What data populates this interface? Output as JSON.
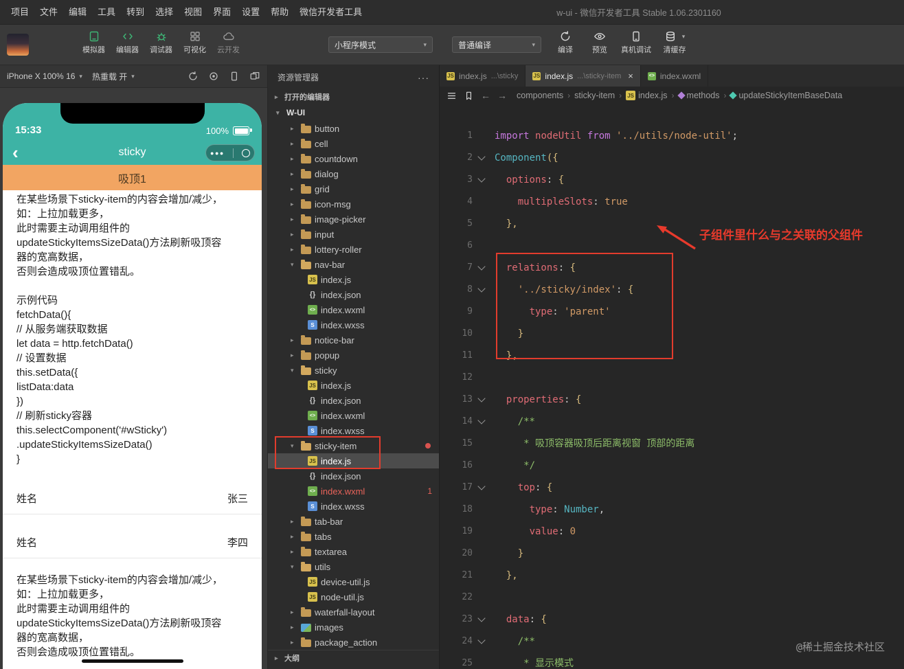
{
  "colors": {
    "accent_green": "#3eb575",
    "phone_teal": "#3db3a5",
    "sticky_orange": "#f2a562",
    "annotation_red": "#e83a2c",
    "error_red": "#e9635a"
  },
  "menubar": {
    "items": [
      "项目",
      "文件",
      "编辑",
      "工具",
      "转到",
      "选择",
      "视图",
      "界面",
      "设置",
      "帮助",
      "微信开发者工具"
    ],
    "title": "w-ui - 微信开发者工具 Stable 1.06.2301160"
  },
  "toolbar": {
    "left_buttons": [
      {
        "label": "模拟器",
        "icon": "simulator-icon",
        "state": "active"
      },
      {
        "label": "编辑器",
        "icon": "editor-icon",
        "state": "active"
      },
      {
        "label": "调试器",
        "icon": "debugger-icon",
        "state": "active"
      },
      {
        "label": "可视化",
        "icon": "visual-icon",
        "state": "normal"
      },
      {
        "label": "云开发",
        "icon": "cloud-icon",
        "state": "disabled"
      }
    ],
    "mode_dropdown": {
      "value": "小程序模式"
    },
    "compile_dropdown": {
      "value": "普通编译"
    },
    "actions": [
      {
        "label": "编译",
        "icon": "compile-icon",
        "has_caret": false
      },
      {
        "label": "预览",
        "icon": "preview-icon",
        "has_caret": false
      },
      {
        "label": "真机调试",
        "icon": "phone-debug-icon",
        "has_caret": false
      },
      {
        "label": "清缓存",
        "icon": "clear-cache-icon",
        "has_caret": true
      }
    ]
  },
  "simulator": {
    "device_label": "iPhone X 100% 16",
    "hot_reload_label": "热重载 开",
    "phone": {
      "time": "15:33",
      "battery": "100%",
      "nav_title": "sticky",
      "sticky_header": "吸顶1",
      "para1": [
        "在某些场景下sticky-item的内容会增加/减少，",
        "如：上拉加载更多，",
        "此时需要主动调用组件的",
        "updateStickyItemsSizeData()方法刷新吸顶容",
        "器的宽高数据，",
        "否则会造成吸顶位置错乱。",
        "",
        "示例代码",
        "fetchData(){",
        "// 从服务端获取数据",
        "let data = http.fetchData()",
        "// 设置数据",
        "this.setData({",
        "listData:data",
        "})",
        "// 刷新sticky容器",
        "this.selectComponent('#wSticky')",
        ".updateStickyItemsSizeData()",
        "}"
      ],
      "rows": [
        {
          "label": "姓名",
          "value": "张三"
        },
        {
          "label": "姓名",
          "value": "李四"
        }
      ],
      "para2": [
        "在某些场景下sticky-item的内容会增加/减少，",
        "如：上拉加载更多，",
        "此时需要主动调用组件的",
        "updateStickyItemsSizeData()方法刷新吸顶容",
        "器的宽高数据，",
        "否则会造成吸顶位置错乱。"
      ]
    }
  },
  "explorer": {
    "title": "资源管理器",
    "opened_editors_label": "打开的编辑器",
    "root_label": "W-UI",
    "outline_label": "大纲",
    "tree": [
      {
        "label": "button",
        "level": 1,
        "kind": "folder",
        "expanded": false
      },
      {
        "label": "cell",
        "level": 1,
        "kind": "folder",
        "expanded": false
      },
      {
        "label": "countdown",
        "level": 1,
        "kind": "folder",
        "expanded": false
      },
      {
        "label": "dialog",
        "level": 1,
        "kind": "folder",
        "expanded": false
      },
      {
        "label": "grid",
        "level": 1,
        "kind": "folder",
        "expanded": false
      },
      {
        "label": "icon-msg",
        "level": 1,
        "kind": "folder",
        "expanded": false
      },
      {
        "label": "image-picker",
        "level": 1,
        "kind": "folder",
        "expanded": false
      },
      {
        "label": "input",
        "level": 1,
        "kind": "folder",
        "expanded": false
      },
      {
        "label": "lottery-roller",
        "level": 1,
        "kind": "folder",
        "expanded": false
      },
      {
        "label": "nav-bar",
        "level": 1,
        "kind": "folder",
        "expanded": true
      },
      {
        "label": "index.js",
        "level": 2,
        "kind": "file",
        "icon": "js"
      },
      {
        "label": "index.json",
        "level": 2,
        "kind": "file",
        "icon": "json"
      },
      {
        "label": "index.wxml",
        "level": 2,
        "kind": "file",
        "icon": "wxml"
      },
      {
        "label": "index.wxss",
        "level": 2,
        "kind": "file",
        "icon": "wxss"
      },
      {
        "label": "notice-bar",
        "level": 1,
        "kind": "folder",
        "expanded": false
      },
      {
        "label": "popup",
        "level": 1,
        "kind": "folder",
        "expanded": false
      },
      {
        "label": "sticky",
        "level": 1,
        "kind": "folder",
        "expanded": true
      },
      {
        "label": "index.js",
        "level": 2,
        "kind": "file",
        "icon": "js"
      },
      {
        "label": "index.json",
        "level": 2,
        "kind": "file",
        "icon": "json"
      },
      {
        "label": "index.wxml",
        "level": 2,
        "kind": "file",
        "icon": "wxml"
      },
      {
        "label": "index.wxss",
        "level": 2,
        "kind": "file",
        "icon": "wxss"
      },
      {
        "label": "sticky-item",
        "level": 1,
        "kind": "folder",
        "expanded": true,
        "dot": true
      },
      {
        "label": "index.js",
        "level": 2,
        "kind": "file",
        "icon": "js",
        "selected": true
      },
      {
        "label": "index.json",
        "level": 2,
        "kind": "file",
        "icon": "json"
      },
      {
        "label": "index.wxml",
        "level": 2,
        "kind": "file",
        "icon": "wxml",
        "error": true,
        "badge": "1"
      },
      {
        "label": "index.wxss",
        "level": 2,
        "kind": "file",
        "icon": "wxss"
      },
      {
        "label": "tab-bar",
        "level": 1,
        "kind": "folder",
        "expanded": false
      },
      {
        "label": "tabs",
        "level": 1,
        "kind": "folder",
        "expanded": false
      },
      {
        "label": "textarea",
        "level": 1,
        "kind": "folder",
        "expanded": false
      },
      {
        "label": "utils",
        "level": 1,
        "kind": "folder",
        "expanded": true
      },
      {
        "label": "device-util.js",
        "level": 2,
        "kind": "file",
        "icon": "js"
      },
      {
        "label": "node-util.js",
        "level": 2,
        "kind": "file",
        "icon": "js"
      },
      {
        "label": "waterfall-layout",
        "level": 1,
        "kind": "folder",
        "expanded": false
      },
      {
        "label": "images",
        "level": 1,
        "kind": "folder",
        "icon": "images",
        "expanded": false
      },
      {
        "label": "package_action",
        "level": 1,
        "kind": "folder",
        "expanded": false
      }
    ]
  },
  "editor": {
    "tabs": [
      {
        "label": "index.js",
        "hint": "...\\sticky",
        "icon": "js",
        "active": false,
        "closable": false
      },
      {
        "label": "index.js",
        "hint": "...\\sticky-item",
        "icon": "js",
        "active": true,
        "closable": true
      },
      {
        "label": "index.wxml",
        "hint": "",
        "icon": "wxml",
        "active": false,
        "closable": false
      }
    ],
    "breadcrumb": [
      {
        "label": "components",
        "icon": ""
      },
      {
        "label": "sticky-item",
        "icon": ""
      },
      {
        "label": "index.js",
        "icon": "js"
      },
      {
        "label": "methods",
        "icon": "sym-method"
      },
      {
        "label": "updateStickyItemBaseData",
        "icon": "sym-field"
      }
    ],
    "code": {
      "lines": [
        {
          "n": 1,
          "i": 0,
          "f": false,
          "t": [
            [
              "kw",
              "import "
            ],
            [
              "def",
              "nodeUtil"
            ],
            [
              "kw",
              " from "
            ],
            [
              "str",
              "'../utils/node-util'"
            ],
            [
              "pun",
              ";"
            ]
          ]
        },
        {
          "n": 2,
          "i": 0,
          "f": true,
          "t": [
            [
              "cls",
              "Component"
            ],
            [
              "br",
              "({"
            ]
          ]
        },
        {
          "n": 3,
          "i": 2,
          "f": true,
          "t": [
            [
              "prop",
              "options"
            ],
            [
              "pun",
              ": "
            ],
            [
              "br",
              "{"
            ]
          ]
        },
        {
          "n": 4,
          "i": 4,
          "f": false,
          "t": [
            [
              "prop",
              "multipleSlots"
            ],
            [
              "pun",
              ": "
            ],
            [
              "lit",
              "true"
            ]
          ]
        },
        {
          "n": 5,
          "i": 2,
          "f": false,
          "t": [
            [
              "br",
              "},"
            ]
          ]
        },
        {
          "n": 6,
          "i": 0,
          "f": false,
          "t": []
        },
        {
          "n": 7,
          "i": 2,
          "f": true,
          "t": [
            [
              "prop",
              "relations"
            ],
            [
              "pun",
              ": "
            ],
            [
              "br",
              "{"
            ]
          ]
        },
        {
          "n": 8,
          "i": 4,
          "f": true,
          "t": [
            [
              "str",
              "'../sticky/index'"
            ],
            [
              "pun",
              ": "
            ],
            [
              "br",
              "{"
            ]
          ]
        },
        {
          "n": 9,
          "i": 6,
          "f": false,
          "t": [
            [
              "prop",
              "type"
            ],
            [
              "pun",
              ": "
            ],
            [
              "str",
              "'parent'"
            ]
          ]
        },
        {
          "n": 10,
          "i": 4,
          "f": false,
          "t": [
            [
              "br",
              "}"
            ]
          ]
        },
        {
          "n": 11,
          "i": 2,
          "f": false,
          "t": [
            [
              "br",
              "},"
            ]
          ]
        },
        {
          "n": 12,
          "i": 0,
          "f": false,
          "t": []
        },
        {
          "n": 13,
          "i": 2,
          "f": true,
          "t": [
            [
              "prop",
              "properties"
            ],
            [
              "pun",
              ": "
            ],
            [
              "br",
              "{"
            ]
          ]
        },
        {
          "n": 14,
          "i": 4,
          "f": true,
          "t": [
            [
              "com",
              "/**"
            ]
          ]
        },
        {
          "n": 15,
          "i": 5,
          "f": false,
          "t": [
            [
              "com",
              "* 吸顶容器吸顶后距离视窗 顶部的距离"
            ]
          ]
        },
        {
          "n": 16,
          "i": 5,
          "f": false,
          "t": [
            [
              "com",
              "*/"
            ]
          ]
        },
        {
          "n": 17,
          "i": 4,
          "f": true,
          "t": [
            [
              "prop",
              "top"
            ],
            [
              "pun",
              ": "
            ],
            [
              "br",
              "{"
            ]
          ]
        },
        {
          "n": 18,
          "i": 6,
          "f": false,
          "t": [
            [
              "prop",
              "type"
            ],
            [
              "pun",
              ": "
            ],
            [
              "cls",
              "Number"
            ],
            [
              "pun",
              ","
            ]
          ]
        },
        {
          "n": 19,
          "i": 6,
          "f": false,
          "t": [
            [
              "prop",
              "value"
            ],
            [
              "pun",
              ": "
            ],
            [
              "lit",
              "0"
            ]
          ]
        },
        {
          "n": 20,
          "i": 4,
          "f": false,
          "t": [
            [
              "br",
              "}"
            ]
          ]
        },
        {
          "n": 21,
          "i": 2,
          "f": false,
          "t": [
            [
              "br",
              "},"
            ]
          ]
        },
        {
          "n": 22,
          "i": 0,
          "f": false,
          "t": []
        },
        {
          "n": 23,
          "i": 2,
          "f": true,
          "t": [
            [
              "prop",
              "data"
            ],
            [
              "pun",
              ": "
            ],
            [
              "br",
              "{"
            ]
          ]
        },
        {
          "n": 24,
          "i": 4,
          "f": true,
          "t": [
            [
              "com",
              "/**"
            ]
          ]
        },
        {
          "n": 25,
          "i": 5,
          "f": false,
          "t": [
            [
              "com",
              "* 显示模式"
            ]
          ]
        }
      ]
    },
    "annotation": {
      "text": "子组件里什么与之关联的父组件"
    },
    "watermark": "@稀土掘金技术社区"
  }
}
